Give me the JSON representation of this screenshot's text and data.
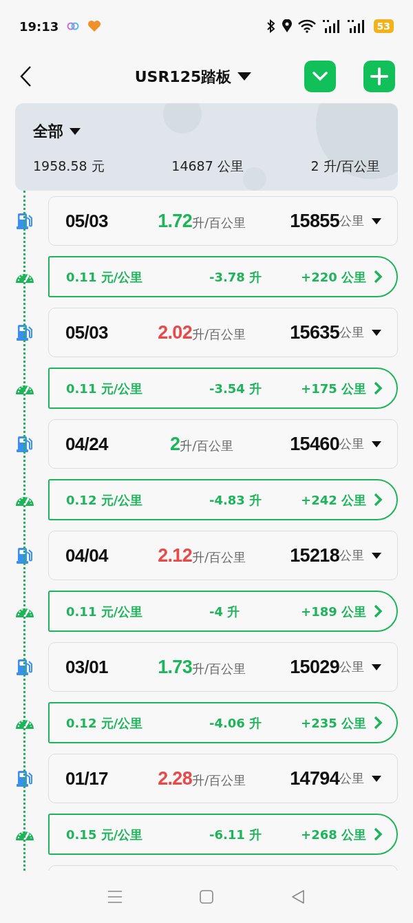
{
  "status_bar": {
    "time": "19:13",
    "battery": "53"
  },
  "header": {
    "title": "USR125踏板"
  },
  "summary": {
    "filter": "全部",
    "cost": "1958.58 元",
    "distance": "14687 公里",
    "consumption": "2 升/百公里"
  },
  "entries": [
    {
      "date": "05/03",
      "efficiency": "1.72",
      "efficiency_unit": "升/百公里",
      "color": "#1db45a",
      "odometer": "15855",
      "odometer_unit": "公里",
      "cost_per_km": "0.11 元/公里",
      "fuel": "-3.78 升",
      "trip": "+220 公里"
    },
    {
      "date": "05/03",
      "efficiency": "2.02",
      "efficiency_unit": "升/百公里",
      "color": "#e84a4a",
      "odometer": "15635",
      "odometer_unit": "公里",
      "cost_per_km": "0.11 元/公里",
      "fuel": "-3.54 升",
      "trip": "+175 公里"
    },
    {
      "date": "04/24",
      "efficiency": "2",
      "efficiency_unit": "升/百公里",
      "color": "#1db45a",
      "odometer": "15460",
      "odometer_unit": "公里",
      "cost_per_km": "0.12 元/公里",
      "fuel": "-4.83 升",
      "trip": "+242 公里"
    },
    {
      "date": "04/04",
      "efficiency": "2.12",
      "efficiency_unit": "升/百公里",
      "color": "#e84a4a",
      "odometer": "15218",
      "odometer_unit": "公里",
      "cost_per_km": "0.11 元/公里",
      "fuel": "-4 升",
      "trip": "+189 公里"
    },
    {
      "date": "03/01",
      "efficiency": "1.73",
      "efficiency_unit": "升/百公里",
      "color": "#1db45a",
      "odometer": "15029",
      "odometer_unit": "公里",
      "cost_per_km": "0.12 元/公里",
      "fuel": "-4.06 升",
      "trip": "+235 公里"
    },
    {
      "date": "01/17",
      "efficiency": "2.28",
      "efficiency_unit": "升/百公里",
      "color": "#e84a4a",
      "odometer": "14794",
      "odometer_unit": "公里",
      "cost_per_km": "0.15 元/公里",
      "fuel": "-6.11 升",
      "trip": "+268 公里"
    }
  ]
}
